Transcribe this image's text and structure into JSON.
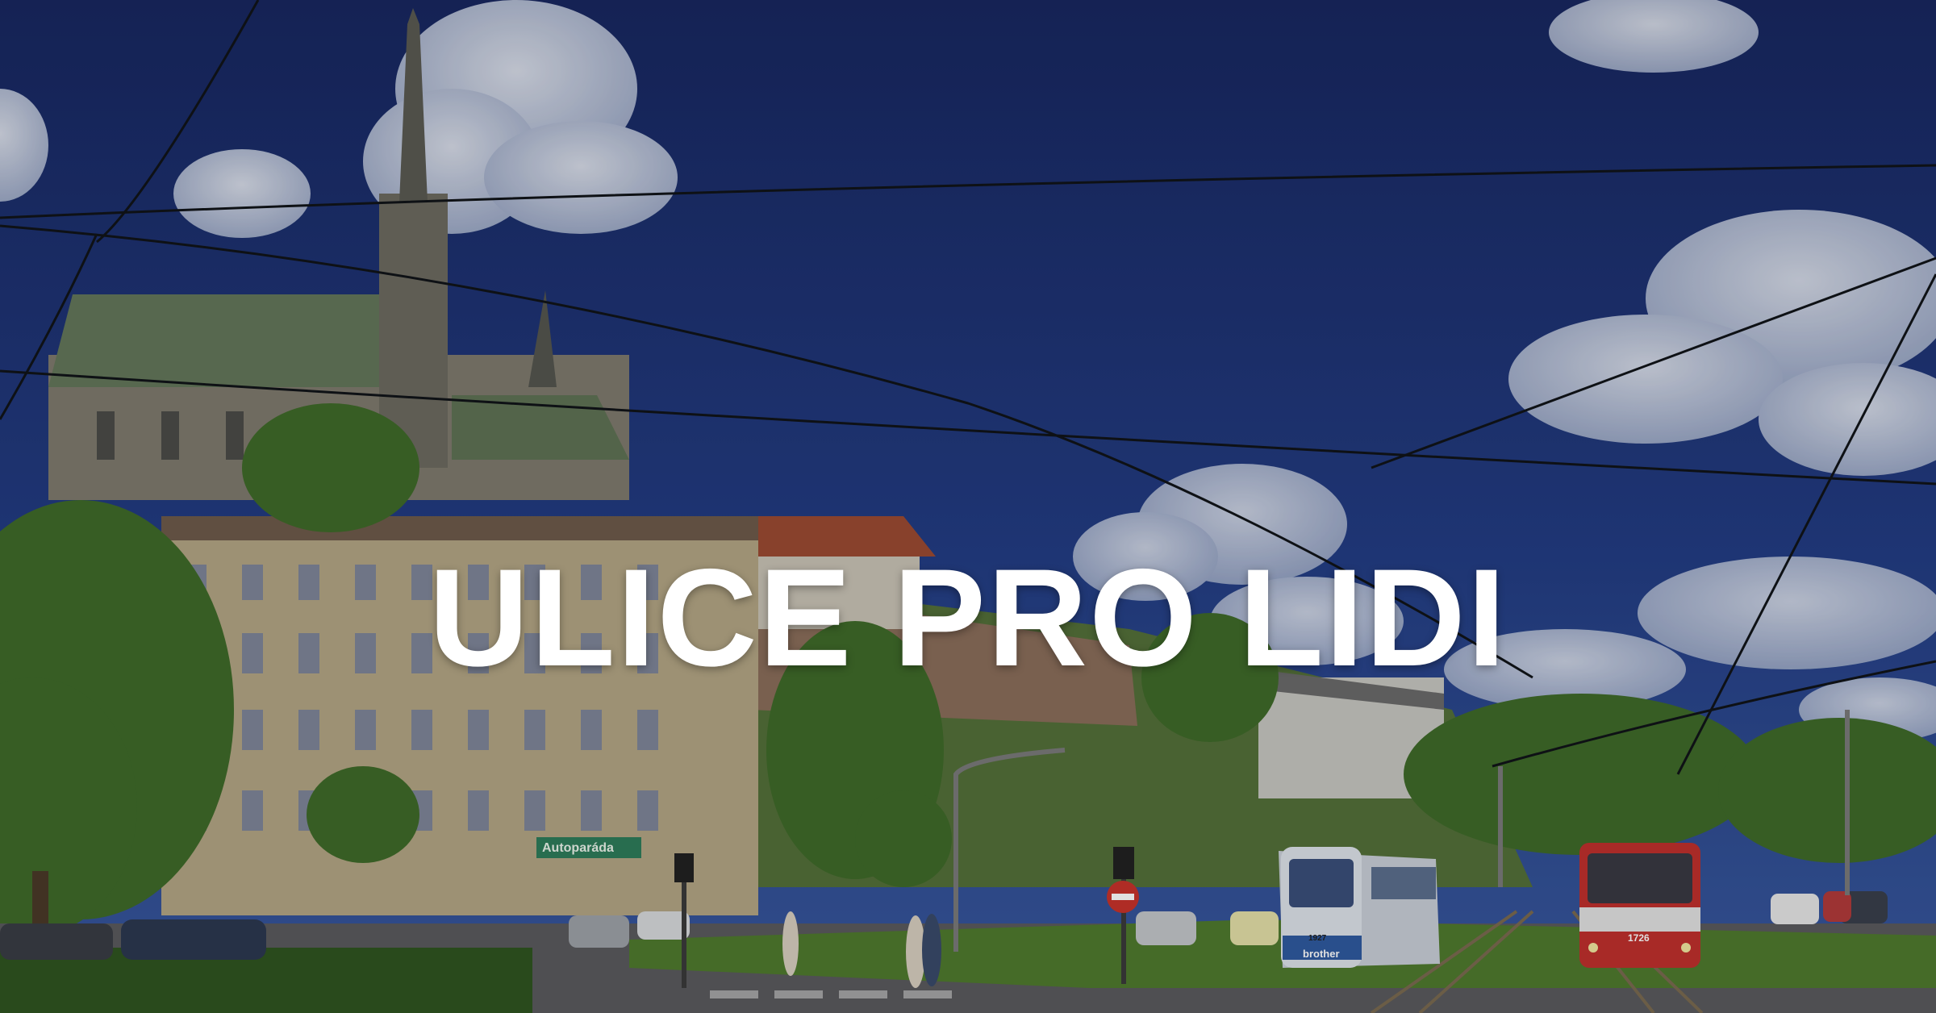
{
  "hero": {
    "headline": "ULICE PRO LIDI",
    "shop_sign": "Autoparáda",
    "tram_left_number": "1927",
    "tram_right_number": "1726",
    "tram_ad": "brother"
  },
  "colors": {
    "sky_top": "#1a2b66",
    "sky_bottom": "#34529a",
    "headline": "#ffffff",
    "cathedral_roof": "#6a7d55",
    "building_facade": "#b8ab8a",
    "tram_red": "#c0302d",
    "grass": "#4f7a2e"
  },
  "icons": [
    "cloud-shape",
    "cathedral-spire",
    "tram",
    "traffic-light",
    "no-entry-sign",
    "street-lamp",
    "tree"
  ]
}
